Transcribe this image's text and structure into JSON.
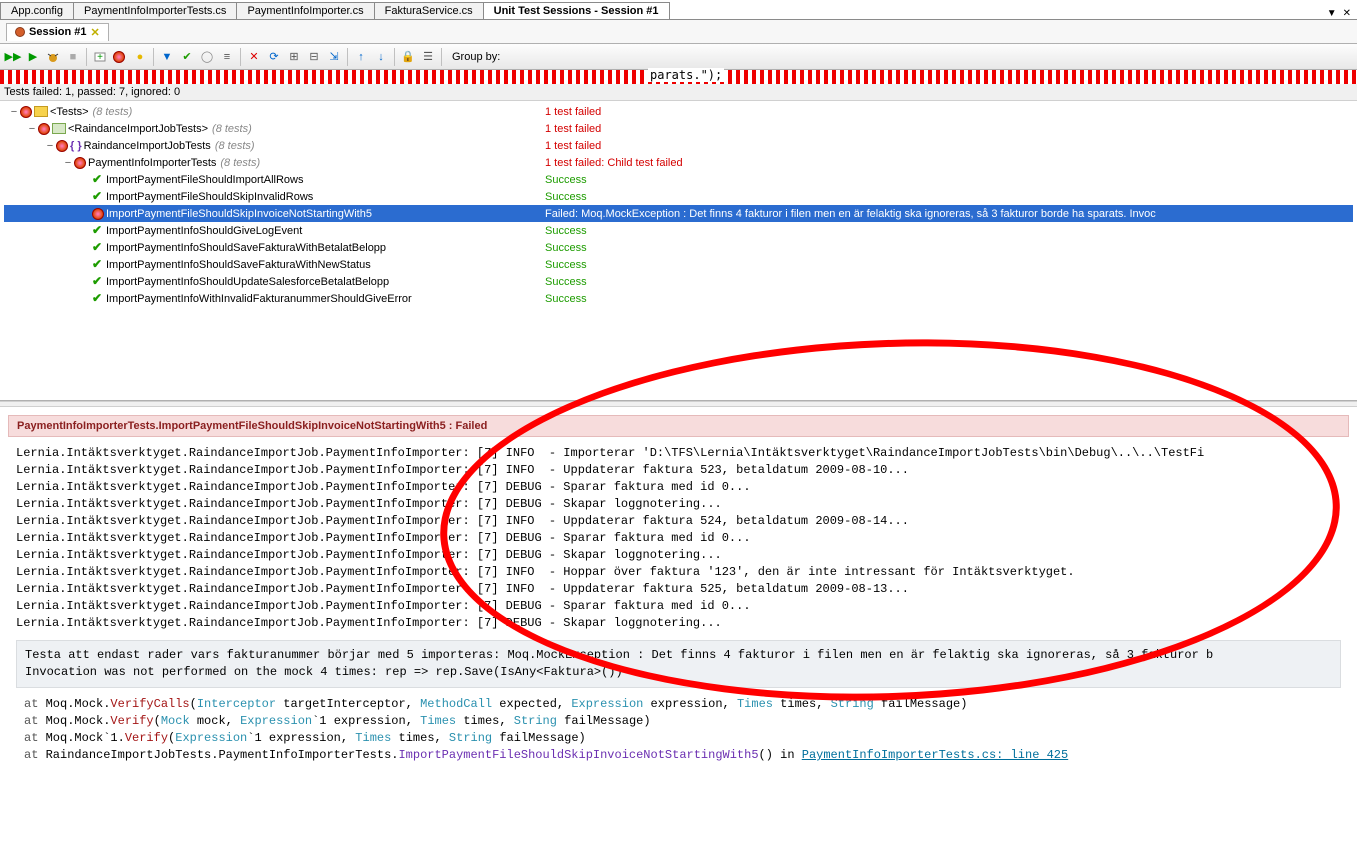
{
  "file_tabs": [
    {
      "label": "App.config",
      "active": false
    },
    {
      "label": "PaymentInfoImporterTests.cs",
      "active": false
    },
    {
      "label": "PaymentInfoImporter.cs",
      "active": false
    },
    {
      "label": "FakturaService.cs",
      "active": false
    },
    {
      "label": "Unit Test Sessions - Session #1",
      "active": true
    }
  ],
  "session_tab": {
    "label": "Session #1"
  },
  "toolbar": {
    "group_by_label": "Group by:"
  },
  "red_strip_text": "parats.\");",
  "status_line": "Tests failed: 1, passed: 7, ignored: 0",
  "tree": [
    {
      "depth": 0,
      "toggle": "−",
      "icon": "fail",
      "extra_icon": "folder",
      "name": "<Tests>",
      "sub": "(8 tests)",
      "status": "1 test failed",
      "status_class": "fail",
      "selected": false
    },
    {
      "depth": 1,
      "toggle": "−",
      "icon": "fail",
      "extra_icon": "proj",
      "name": "<RaindanceImportJobTests>",
      "sub": "(8 tests)",
      "status": "1 test failed",
      "status_class": "fail",
      "selected": false
    },
    {
      "depth": 2,
      "toggle": "−",
      "icon": "fail",
      "extra_icon": "ns",
      "name": "RaindanceImportJobTests",
      "sub": "(8 tests)",
      "status": "1 test failed",
      "status_class": "fail",
      "selected": false
    },
    {
      "depth": 3,
      "toggle": "−",
      "icon": "fail",
      "extra_icon": "",
      "name": "PaymentInfoImporterTests",
      "sub": "(8 tests)",
      "status": "1 test failed: Child test failed",
      "status_class": "fail",
      "selected": false
    },
    {
      "depth": 4,
      "toggle": "",
      "icon": "pass",
      "extra_icon": "",
      "name": "ImportPaymentFileShouldImportAllRows",
      "sub": "",
      "status": "Success",
      "status_class": "ok",
      "selected": false
    },
    {
      "depth": 4,
      "toggle": "",
      "icon": "pass",
      "extra_icon": "",
      "name": "ImportPaymentFileShouldSkipInvalidRows",
      "sub": "",
      "status": "Success",
      "status_class": "ok",
      "selected": false
    },
    {
      "depth": 4,
      "toggle": "",
      "icon": "fail",
      "extra_icon": "",
      "name": "ImportPaymentFileShouldSkipInvoiceNotStartingWith5",
      "sub": "",
      "status": "Failed: Moq.MockException : Det finns 4 fakturor i filen men en är felaktig ska ignoreras, så 3 fakturor borde ha sparats. Invoc",
      "status_class": "fail",
      "selected": true
    },
    {
      "depth": 4,
      "toggle": "",
      "icon": "pass",
      "extra_icon": "",
      "name": "ImportPaymentInfoShouldGiveLogEvent",
      "sub": "",
      "status": "Success",
      "status_class": "ok",
      "selected": false
    },
    {
      "depth": 4,
      "toggle": "",
      "icon": "pass",
      "extra_icon": "",
      "name": "ImportPaymentInfoShouldSaveFakturaWithBetalatBelopp",
      "sub": "",
      "status": "Success",
      "status_class": "ok",
      "selected": false
    },
    {
      "depth": 4,
      "toggle": "",
      "icon": "pass",
      "extra_icon": "",
      "name": "ImportPaymentInfoShouldSaveFakturaWithNewStatus",
      "sub": "",
      "status": "Success",
      "status_class": "ok",
      "selected": false
    },
    {
      "depth": 4,
      "toggle": "",
      "icon": "pass",
      "extra_icon": "",
      "name": "ImportPaymentInfoShouldUpdateSalesforceBetalatBelopp",
      "sub": "",
      "status": "Success",
      "status_class": "ok",
      "selected": false
    },
    {
      "depth": 4,
      "toggle": "",
      "icon": "pass",
      "extra_icon": "",
      "name": "ImportPaymentInfoWithInvalidFakturanummerShouldGiveError",
      "sub": "",
      "status": "Success",
      "status_class": "ok",
      "selected": false
    }
  ],
  "fail_banner": "PaymentInfoImporterTests.ImportPaymentFileShouldSkipInvoiceNotStartingWith5 : Failed",
  "log_lines": [
    "Lernia.Intäktsverktyget.RaindanceImportJob.PaymentInfoImporter: [7] INFO  - Importerar 'D:\\TFS\\Lernia\\Intäktsverktyget\\RaindanceImportJobTests\\bin\\Debug\\..\\..\\TestFi",
    "Lernia.Intäktsverktyget.RaindanceImportJob.PaymentInfoImporter: [7] INFO  - Uppdaterar faktura 523, betaldatum 2009-08-10...",
    "Lernia.Intäktsverktyget.RaindanceImportJob.PaymentInfoImporter: [7] DEBUG - Sparar faktura med id 0...",
    "Lernia.Intäktsverktyget.RaindanceImportJob.PaymentInfoImporter: [7] DEBUG - Skapar loggnotering...",
    "Lernia.Intäktsverktyget.RaindanceImportJob.PaymentInfoImporter: [7] INFO  - Uppdaterar faktura 524, betaldatum 2009-08-14...",
    "Lernia.Intäktsverktyget.RaindanceImportJob.PaymentInfoImporter: [7] DEBUG - Sparar faktura med id 0...",
    "Lernia.Intäktsverktyget.RaindanceImportJob.PaymentInfoImporter: [7] DEBUG - Skapar loggnotering...",
    "Lernia.Intäktsverktyget.RaindanceImportJob.PaymentInfoImporter: [7] INFO  - Hoppar över faktura '123', den är inte intressant för Intäktsverktyget.",
    "Lernia.Intäktsverktyget.RaindanceImportJob.PaymentInfoImporter: [7] INFO  - Uppdaterar faktura 525, betaldatum 2009-08-13...",
    "Lernia.Intäktsverktyget.RaindanceImportJob.PaymentInfoImporter: [7] DEBUG - Sparar faktura med id 0...",
    "Lernia.Intäktsverktyget.RaindanceImportJob.PaymentInfoImporter: [7] DEBUG - Skapar loggnotering..."
  ],
  "err_lines": [
    "Testa att endast rader vars fakturanummer börjar med 5 importeras: Moq.MockException : Det finns 4 fakturor i filen men en är felaktig ska ignoreras, så 3 fakturor b",
    "Invocation was not performed on the mock 4 times: rep => rep.Save(IsAny<Faktura>())"
  ],
  "stack": [
    {
      "at": "at ",
      "pre": "Moq.Mock.",
      "method": "VerifyCalls",
      "args": "(Interceptor targetInterceptor, MethodCall expected, Expression expression, Times times, String failMessage)",
      "types": [
        "Interceptor",
        "MethodCall",
        "Expression",
        "Times",
        "String"
      ]
    },
    {
      "at": "at ",
      "pre": "Moq.Mock.",
      "method": "Verify",
      "args": "(Mock mock, Expression`1 expression, Times times, String failMessage)",
      "types": [
        "Mock",
        "Expression",
        "Times",
        "String"
      ]
    },
    {
      "at": "at ",
      "pre": "Moq.Mock`1.",
      "method": "Verify",
      "args": "(Expression`1 expression, Times times, String failMessage)",
      "types": [
        "Expression",
        "Times",
        "String"
      ]
    },
    {
      "at": "at ",
      "pre": "RaindanceImportJobTests.PaymentInfoImporterTests.",
      "method": "ImportPaymentFileShouldSkipInvoiceNotStartingWith5",
      "args": "() in ",
      "file": "PaymentInfoImporterTests.cs: line 425",
      "types": [],
      "is_link": true
    }
  ]
}
